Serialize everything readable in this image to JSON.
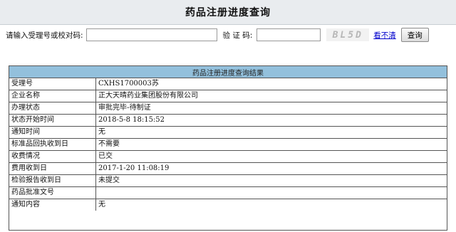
{
  "page": {
    "title": "药品注册进度查询"
  },
  "search": {
    "label": "请输入受理号或校对码:",
    "value": "",
    "verify_label": "验 证 码:",
    "verify_value": "",
    "captcha_text": "BL5D",
    "refresh_label": "看不清",
    "query_button": "查询"
  },
  "results": {
    "header": "药品注册进度查询结果",
    "rows": [
      {
        "label": "受理号",
        "value": "CXHS1700003苏"
      },
      {
        "label": "企业名称",
        "value": "正大天晴药业集团股份有限公司"
      },
      {
        "label": "办理状态",
        "value": "审批完毕-待制证"
      },
      {
        "label": "状态开始时间",
        "value": "2018-5-8 18:15:52"
      },
      {
        "label": "通知时间",
        "value": "无"
      },
      {
        "label": "标准品回执收到日",
        "value": "不需要"
      },
      {
        "label": "收费情况",
        "value": "已交"
      },
      {
        "label": "费用收到日",
        "value": "2017-1-20 11:08:19"
      },
      {
        "label": "检验报告收到日",
        "value": "未提交"
      },
      {
        "label": "药品批准文号",
        "value": ""
      },
      {
        "label": "通知内容",
        "value": "无"
      }
    ]
  },
  "colors": {
    "header_bg": "#93c0dc",
    "title_bar_bg": "#e9ecef",
    "link": "#0000cc"
  }
}
